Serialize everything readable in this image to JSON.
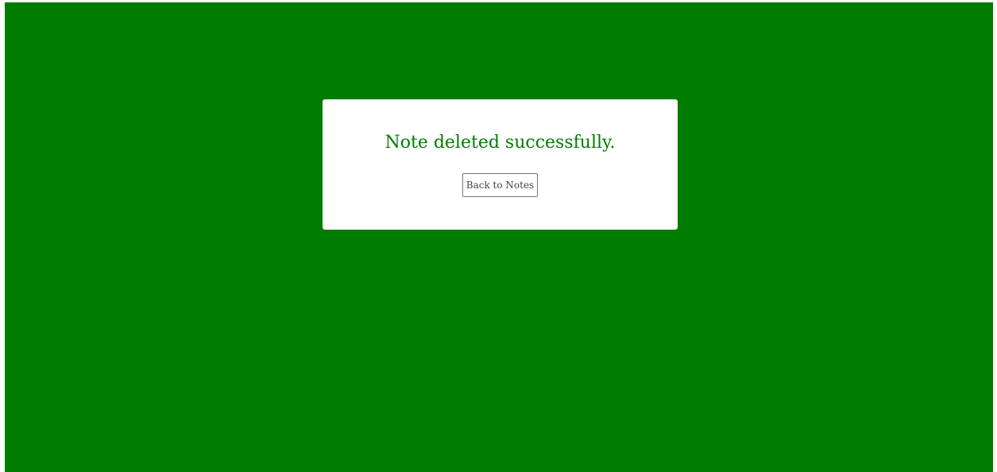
{
  "dialog": {
    "message": "Note deleted successfully.",
    "back_button_label": "Back to Notes"
  },
  "colors": {
    "background": "#007d00",
    "card": "#ffffff",
    "message_text": "#007d00"
  }
}
